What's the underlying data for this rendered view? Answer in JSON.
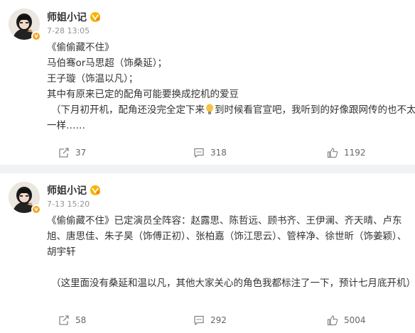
{
  "posts": [
    {
      "username": "师姐小记",
      "time": "7-28 13:05",
      "lines": [
        "《偷偷藏不住》",
        "马伯骞or马思超（饰桑延）；",
        "王子璇（饰温以凡）；",
        "其中有原来已定的配角可能要换成挖机的爱豆"
      ],
      "line_last_before": "（下月初开机，配角还没完全定下来",
      "line_last_after": "到时候看官宣吧，我听到的好像跟网传的也不太",
      "line_last_end": "一样……",
      "forwards": "37",
      "comments": "318",
      "likes": "1192"
    },
    {
      "username": "师姐小记",
      "time": "7-13 15:20",
      "paragraph": "《偷偷藏不住》已定演员全阵容：赵露思、陈哲远、顾书齐、王伊澜、齐天晴、卢东旭、唐思佳、朱子昊（饰傅正初）、张柏嘉（饰江思云）、管梓净、徐世昕（饰姜颖）、胡宇轩",
      "note": "（这里面没有桑延和温以凡，其他大家关心的角色我都标注了一下，预计七月底开机）",
      "forwards": "58",
      "comments": "292",
      "likes": "5004"
    }
  ],
  "icons": {
    "forward": "forward-icon",
    "comment": "comment-icon",
    "like": "like-icon",
    "vip": "vip-badge-icon",
    "verified": "verified-badge-icon"
  },
  "colors": {
    "meta": "#939393",
    "text": "#333333",
    "badge": "#f5a623",
    "background": "#f1f2f3"
  }
}
